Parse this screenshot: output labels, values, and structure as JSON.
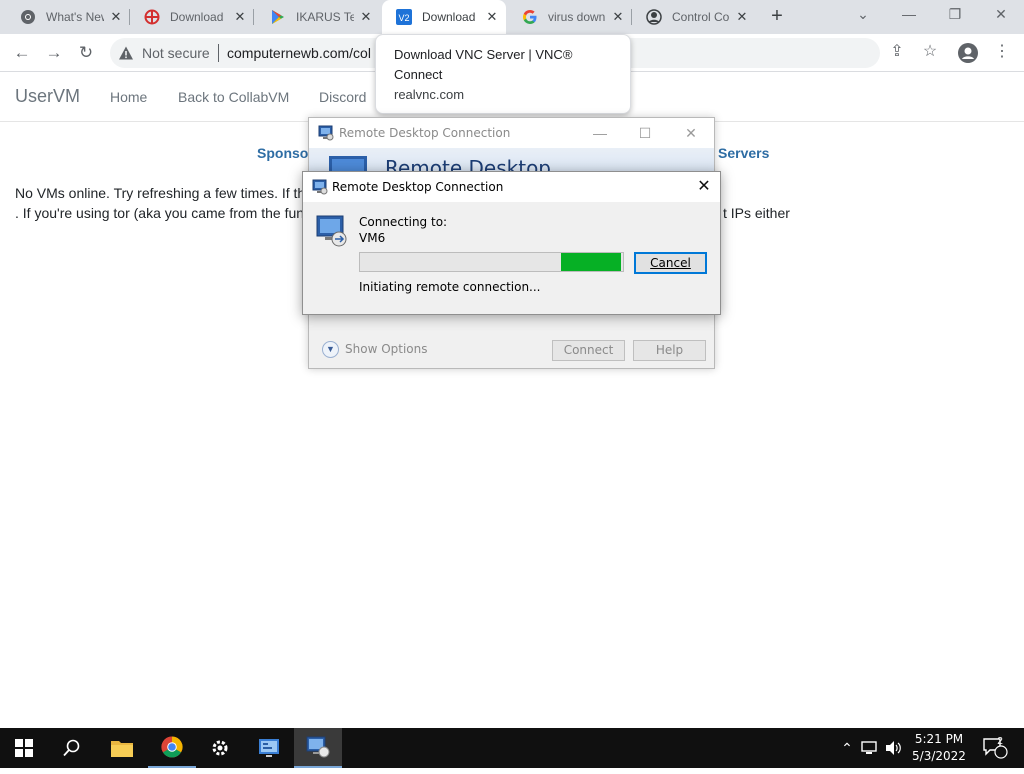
{
  "browser": {
    "tabs": [
      {
        "title": "What's New",
        "icon": "chrome-icon",
        "active": false
      },
      {
        "title": "Download",
        "icon": "ikarus-red-icon",
        "active": false
      },
      {
        "title": "IKARUS Te",
        "icon": "play-store-icon",
        "active": false
      },
      {
        "title": "Download",
        "icon": "vnc-icon",
        "active": true
      },
      {
        "title": "virus down",
        "icon": "google-icon",
        "active": false
      },
      {
        "title": "Control Co",
        "icon": "control-center-icon",
        "active": false
      }
    ],
    "address": {
      "security_label": "Not secure",
      "url": "computernewb.com/col"
    },
    "tooltip": {
      "title": "Download VNC Server | VNC® Connect",
      "domain": "realvnc.com"
    }
  },
  "site": {
    "brand": "UserVM",
    "nav": [
      "Home",
      "Back to CollabVM",
      "Discord"
    ],
    "sections": {
      "left": "Sponso",
      "right": "Servers"
    },
    "body_lines": [
      "No VMs online. Try refreshing a few times. If th",
      ". If you're using tor (aka you came from the fun",
      "t IPs either"
    ]
  },
  "rdp_background": {
    "title": "Remote Desktop Connection",
    "heading": "Remote Desktop",
    "show_options": "Show Options",
    "buttons": {
      "connect": "Connect",
      "help": "Help"
    }
  },
  "rdp_dialog": {
    "title": "Remote Desktop Connection",
    "connecting_label": "Connecting to:",
    "target": "VM6",
    "status": "Initiating remote connection...",
    "cancel_label": "Cancel",
    "progress": {
      "start": 0.765,
      "end": 0.995,
      "indeterminate": true
    }
  },
  "taskbar": {
    "clock_time": "5:21 PM",
    "clock_date": "5/3/2022",
    "notification_count": "2"
  },
  "colors": {
    "accent": "#0078d7",
    "progress": "#06b025",
    "link": "#2e6da4"
  }
}
